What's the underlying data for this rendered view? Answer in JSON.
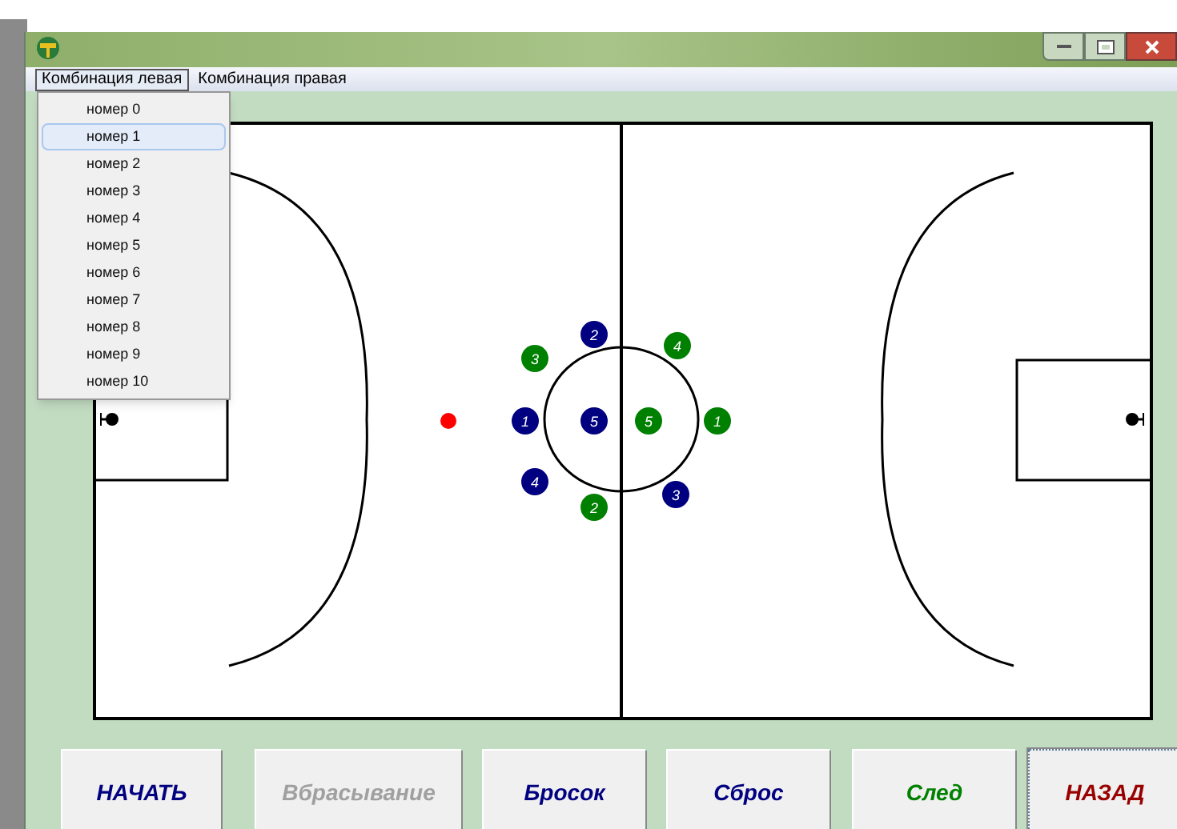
{
  "menu": [
    {
      "label": "Комбинация левая",
      "selected": true
    },
    {
      "label": "Комбинация правая",
      "selected": false
    }
  ],
  "dropdown": [
    {
      "label": "номер 0",
      "selected": false
    },
    {
      "label": "номер 1",
      "selected": true
    },
    {
      "label": "номер 2",
      "selected": false
    },
    {
      "label": "номер 3",
      "selected": false
    },
    {
      "label": "номер 4",
      "selected": false
    },
    {
      "label": "номер 5",
      "selected": false
    },
    {
      "label": "номер 6",
      "selected": false
    },
    {
      "label": "номер 7",
      "selected": false
    },
    {
      "label": "номер 8",
      "selected": false
    },
    {
      "label": "номер 9",
      "selected": false
    },
    {
      "label": "номер 10",
      "selected": false
    }
  ],
  "players": [
    {
      "number": "2",
      "color": "#000080"
    },
    {
      "number": "3",
      "color": "#008000"
    },
    {
      "number": "4",
      "color": "#008000"
    },
    {
      "number": "1",
      "color": "#000080"
    },
    {
      "number": "5",
      "color": "#000080"
    },
    {
      "number": "5",
      "color": "#008000"
    },
    {
      "number": "1",
      "color": "#008000"
    },
    {
      "number": "4",
      "color": "#000080"
    },
    {
      "number": "2",
      "color": "#008000"
    },
    {
      "number": "3",
      "color": "#000080"
    }
  ],
  "buttons": [
    {
      "label": "НАЧАТЬ",
      "color": "#000080",
      "disabled": false,
      "focused": false
    },
    {
      "label": "Вбрасывание",
      "disabled": true,
      "focused": false
    },
    {
      "label": "Бросок",
      "color": "#000080",
      "disabled": false,
      "focused": false
    },
    {
      "label": "Сброс",
      "color": "#000080",
      "disabled": false,
      "focused": false
    },
    {
      "label": "След",
      "color": "#008000",
      "disabled": false,
      "focused": false
    },
    {
      "label": "НАЗАД",
      "color": "#990000",
      "disabled": false,
      "focused": true
    }
  ]
}
